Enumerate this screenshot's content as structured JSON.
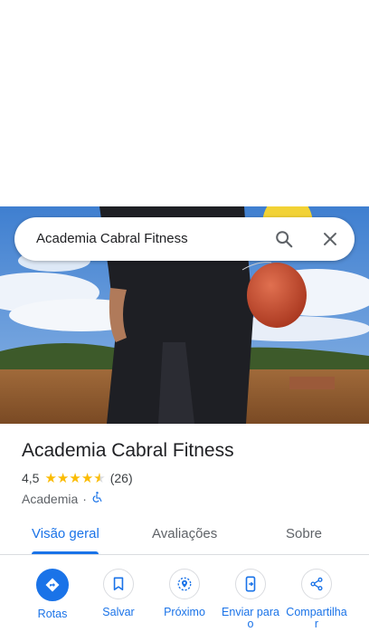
{
  "search": {
    "query": "Academia Cabral Fitness",
    "search_icon": "search-icon",
    "close_icon": "close-icon"
  },
  "place": {
    "name": "Academia Cabral Fitness",
    "rating": "4,5",
    "rating_value": 4.5,
    "review_count": "(26)",
    "category": "Academia",
    "separator": "·",
    "accessibility_icon": "wheelchair-icon"
  },
  "tabs": [
    {
      "label": "Visão geral",
      "active": true
    },
    {
      "label": "Avaliações",
      "active": false
    },
    {
      "label": "Sobre",
      "active": false
    }
  ],
  "actions": [
    {
      "label": "Rotas",
      "icon": "directions-icon"
    },
    {
      "label": "Salvar",
      "icon": "bookmark-icon"
    },
    {
      "label": "Próximo",
      "icon": "nearby-icon"
    },
    {
      "label": "Enviar para",
      "label2": "o",
      "icon": "send-to-phone-icon"
    },
    {
      "label": "Compartilha",
      "label2": "r",
      "icon": "share-icon"
    }
  ],
  "colors": {
    "accent": "#1a73e8",
    "star": "#fbbc04"
  }
}
